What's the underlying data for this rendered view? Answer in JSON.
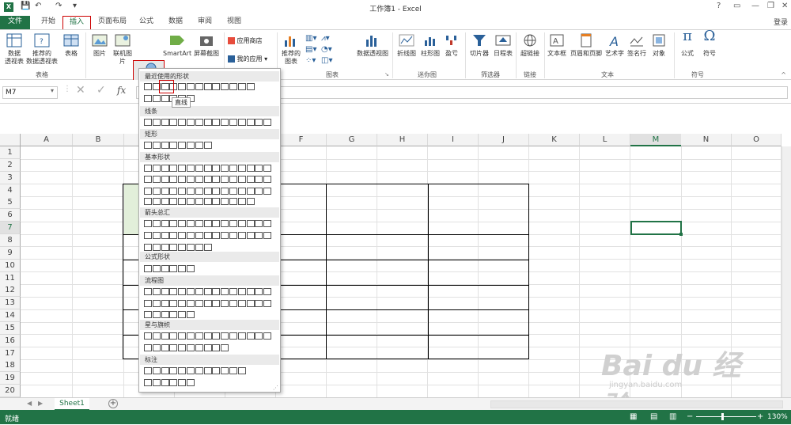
{
  "title": "工作簿1 - Excel",
  "signin": "登录",
  "help": "?",
  "tabs": [
    "文件",
    "开始",
    "插入",
    "页面布局",
    "公式",
    "数据",
    "审阅",
    "视图"
  ],
  "ribbon": {
    "pivot": "数据\n透视表",
    "rec_pivot": "推荐的\n数据透视表",
    "table": "表格",
    "picture": "图片",
    "online_pic": "联机图片",
    "shapes": "形状",
    "smartart": "SmartArt",
    "screenshot": "屏幕截图",
    "store": "应用商店",
    "my_apps": "我的应用",
    "rec_charts": "推荐的\n图表",
    "pivot_chart": "数据透视图",
    "line": "折线图",
    "column": "柱形图",
    "winloss": "盈亏",
    "slicer": "切片器",
    "timeline": "日程表",
    "hyperlink": "超链接",
    "textbox": "文本框",
    "header_footer": "页眉和页脚",
    "wordart": "艺术字",
    "signature": "签名行",
    "object": "对象",
    "equation": "公式",
    "symbol": "符号",
    "groups": {
      "tables": "表格",
      "charts": "图表",
      "sparklines": "迷你图",
      "filters": "筛选器",
      "links": "链接",
      "text": "文本",
      "symbols": "符号"
    }
  },
  "name_box": "M7",
  "fx": "fx",
  "columns": [
    "A",
    "B",
    "C",
    "D",
    "E",
    "F",
    "G",
    "H",
    "I",
    "J",
    "K",
    "L",
    "M",
    "N",
    "O"
  ],
  "rows": [
    "1",
    "2",
    "3",
    "4",
    "5",
    "6",
    "7",
    "8",
    "9",
    "10",
    "11",
    "12",
    "13",
    "14",
    "15",
    "16",
    "17",
    "18",
    "19",
    "20"
  ],
  "dropdown": {
    "sections": [
      "最近使用的形状",
      "线条",
      "矩形",
      "基本形状",
      "箭头总汇",
      "公式形状",
      "流程图",
      "星与旗帜",
      "标注"
    ],
    "tooltip": "直线"
  },
  "sheet_tab": "Sheet1",
  "status": {
    "ready": "就绪",
    "zoom": "130%"
  },
  "watermark": {
    "brand": "Bai du 经验",
    "url": "jingyan.baidu.com"
  }
}
